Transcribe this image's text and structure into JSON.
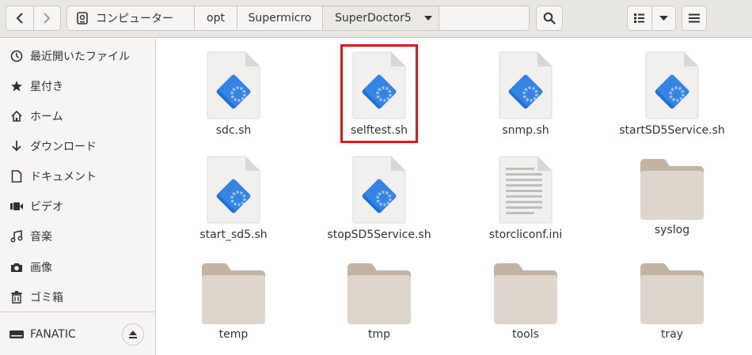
{
  "headerbar": {
    "back_icon": "chevron-left-icon",
    "forward_icon": "chevron-right-icon",
    "breadcrumbs": [
      "コンピューター",
      "opt",
      "Supermicro",
      "SuperDoctor5"
    ],
    "search_icon": "search-icon",
    "view_icon": "list-view-icon",
    "menu_icon": "hamburger-menu-icon"
  },
  "sidebar": {
    "items": [
      {
        "label": "最近開いたファイル",
        "icon": "clock-icon"
      },
      {
        "label": "星付き",
        "icon": "star-icon"
      },
      {
        "label": "ホーム",
        "icon": "home-icon"
      },
      {
        "label": "ダウンロード",
        "icon": "download-icon"
      },
      {
        "label": "ドキュメント",
        "icon": "document-icon"
      },
      {
        "label": "ビデオ",
        "icon": "video-icon"
      },
      {
        "label": "音楽",
        "icon": "music-icon"
      },
      {
        "label": "画像",
        "icon": "camera-icon"
      },
      {
        "label": "ゴミ箱",
        "icon": "trash-icon"
      }
    ],
    "device": {
      "label": "FANATIC",
      "icon": "drive-icon",
      "eject_icon": "eject-icon"
    }
  },
  "files": [
    {
      "name": "sdc.sh",
      "type": "script"
    },
    {
      "name": "selftest.sh",
      "type": "script",
      "highlighted": true
    },
    {
      "name": "snmp.sh",
      "type": "script"
    },
    {
      "name": "startSD5Service.sh",
      "type": "script"
    },
    {
      "name": "start_sd5.sh",
      "type": "script"
    },
    {
      "name": "stopSD5Service.sh",
      "type": "script"
    },
    {
      "name": "storcliconf.ini",
      "type": "text"
    },
    {
      "name": "syslog",
      "type": "folder"
    },
    {
      "name": "temp",
      "type": "folder"
    },
    {
      "name": "tmp",
      "type": "folder"
    },
    {
      "name": "tools",
      "type": "folder"
    },
    {
      "name": "tray",
      "type": "folder"
    }
  ],
  "colors": {
    "highlight": "#e0161a",
    "script_blue": "#3584e4",
    "folder": "#d6cbbf"
  }
}
